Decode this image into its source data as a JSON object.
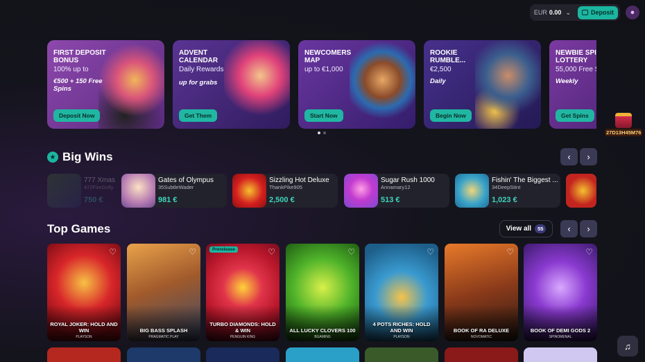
{
  "header": {
    "currency": "EUR",
    "balance": "0.00",
    "deposit_label": "Deposit"
  },
  "promotions": [
    {
      "title": "FIRST DEPOSIT BONUS",
      "sub": "100% up to",
      "highlight": "€500 + 150 Free Spins",
      "cta": "Deposit Now",
      "bg": "#7a3c9c"
    },
    {
      "title": "ADVENT CALENDAR",
      "sub": "Daily Rewards",
      "highlight": "up for grabs",
      "cta": "Get Them",
      "bg": "#4b2a7a"
    },
    {
      "title": "NEWCOMERS MAP",
      "sub": "up to €1,000",
      "highlight": "",
      "cta": "Start Now",
      "bg": "#5b2b8a"
    },
    {
      "title": "ROOKIE RUMBLE...",
      "sub": "€2,500",
      "highlight": "Daily",
      "cta": "Begin Now",
      "bg": "#3a2674"
    },
    {
      "title": "NEWBIE SPIN LOTTERY",
      "sub": "55,000 Free S",
      "highlight": "Weekly",
      "cta": "Get Spins",
      "bg": "#6a2d8e"
    }
  ],
  "timer": "27D13H45M76",
  "big_wins": {
    "title": "Big Wins",
    "items": [
      {
        "game": "777 Xmas",
        "user": "472FireGolly",
        "amount": "750 €",
        "faded": true
      },
      {
        "game": "Gates of Olympus",
        "user": "35SubtleWader",
        "amount": "981 €"
      },
      {
        "game": "Sizzling Hot Deluxe",
        "user": "ThankPike905",
        "amount": "2,500 €"
      },
      {
        "game": "Sugar Rush 1000",
        "user": "Annamary12",
        "amount": "513 €"
      },
      {
        "game": "Fishin' The Biggest ...",
        "user": "34DeepStint",
        "amount": "1,023 €"
      }
    ]
  },
  "top_games": {
    "title": "Top Games",
    "view_all": "View all",
    "count": "55",
    "items": [
      {
        "name": "ROYAL JOKER: HOLD AND WIN",
        "provider": "PLAYSON",
        "badge": ""
      },
      {
        "name": "BIG BASS SPLASH",
        "provider": "PRAGMATIC PLAY",
        "badge": ""
      },
      {
        "name": "TURBO DIAMONDS: HOLD & WIN",
        "provider": "PENGUIN KING",
        "badge": "Prerelease"
      },
      {
        "name": "ALL LUCKY CLOVERS 100",
        "provider": "BGAMING",
        "badge": ""
      },
      {
        "name": "4 POTS RICHES: HOLD AND WIN",
        "provider": "PLAYSON",
        "badge": ""
      },
      {
        "name": "BOOK OF RA DELUXE",
        "provider": "NOVOMATIC",
        "badge": ""
      },
      {
        "name": "BOOK OF DEMI GODS 2",
        "provider": "SPINOMENAL",
        "badge": ""
      }
    ]
  },
  "icons": {
    "star": "star-icon",
    "heart": "heart-icon",
    "chevron_left": "chevron-left-icon",
    "chevron_right": "chevron-right-icon",
    "support": "headset-icon"
  },
  "colors": {
    "accent": "#1bb5a0",
    "win_amount": "#3fd5bd"
  }
}
